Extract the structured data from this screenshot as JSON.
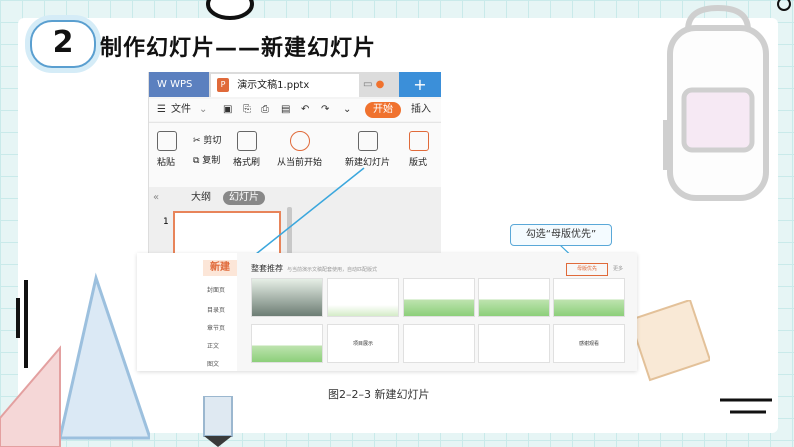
{
  "header": {
    "number": "2",
    "title": "制作幻灯片——新建幻灯片"
  },
  "app": {
    "wps_tab": "WPS",
    "doc_tab": "演示文稿1.pptx",
    "plus": "+",
    "menu": {
      "file": "文件",
      "start": "开始",
      "insert": "插入"
    },
    "ribbon": {
      "paste": "粘贴",
      "cut": "剪切",
      "copy": "复制",
      "format_painter": "格式刷",
      "from_current": "从当前开始",
      "new_slide": "新建幻灯片",
      "layout": "版式"
    },
    "panel": {
      "outline": "大纲",
      "slides": "幻灯片",
      "slide_no": "1"
    }
  },
  "dialog": {
    "new_label": "新建",
    "categories": [
      "封面页",
      "目录页",
      "章节页",
      "正文",
      "图文"
    ],
    "heading": "整套推荐",
    "note": "与当前演示文稿配套使用，自动匹配版式",
    "master_first": "母版优先",
    "more": "更多",
    "thumb_texts": [
      "项目展示",
      "感谢观看"
    ],
    "callout": "勾选“母版优先”"
  },
  "caption": "图2–2–3   新建幻灯片",
  "colors": {
    "accent": "#e06a3a",
    "wps_blue": "#5b80bf",
    "plus_blue": "#3b8fd9",
    "grid_bg": "#e6f5f5"
  }
}
